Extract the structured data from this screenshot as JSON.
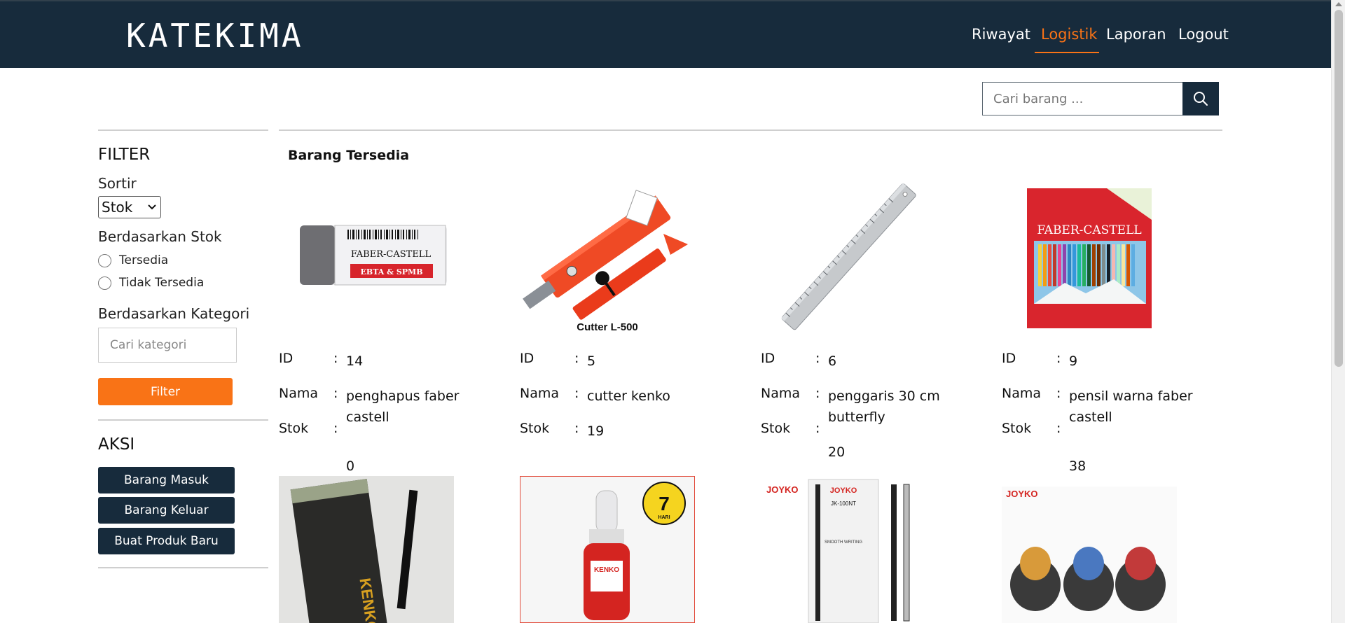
{
  "brand": "KATEKIMA",
  "nav": {
    "items": [
      {
        "label": "Riwayat",
        "active": false
      },
      {
        "label": "Logistik",
        "active": true
      },
      {
        "label": "Laporan",
        "active": false
      },
      {
        "label": "Logout",
        "active": false
      }
    ]
  },
  "search": {
    "placeholder": "Cari barang ...",
    "icon": "search-icon"
  },
  "sidebar": {
    "filter_heading": "FILTER",
    "sortir_label": "Sortir",
    "sortir_selected": "Stok",
    "stok_label": "Berdasarkan Stok",
    "stok_options": [
      "Tersedia",
      "Tidak Tersedia"
    ],
    "kategori_label": "Berdasarkan Kategori",
    "kategori_placeholder": "Cari kategori",
    "filter_button": "Filter",
    "aksi_heading": "AKSI",
    "aksi_buttons": [
      "Barang Masuk",
      "Barang Keluar",
      "Buat Produk Baru"
    ]
  },
  "main": {
    "section_title": "Barang Tersedia",
    "labels": {
      "id": "ID",
      "nama": "Nama",
      "stok": "Stok",
      "sep": ":"
    },
    "products": [
      {
        "id": "14",
        "nama": "penghapus faber castell",
        "stok": "0",
        "image": "eraser",
        "image_text": [
          "FABER-CASTELL",
          "EBTA & SPMB"
        ]
      },
      {
        "id": "5",
        "nama": "cutter kenko",
        "stok": "19",
        "image": "cutter",
        "image_text": [
          "Cutter L-500"
        ]
      },
      {
        "id": "6",
        "nama": "penggaris 30 cm butterfly",
        "stok": "20",
        "image": "ruler",
        "image_text": []
      },
      {
        "id": "9",
        "nama": "pensil warna faber castell",
        "stok": "38",
        "image": "color-pencils",
        "image_text": [
          "FABER-CASTELL"
        ]
      }
    ],
    "bottom_images": [
      {
        "image": "gel-pen-kenko",
        "text": [
          "KENKO"
        ]
      },
      {
        "image": "correction-fluid",
        "text": [
          "KENKO",
          "7",
          "HARI"
        ]
      },
      {
        "image": "gel-pen-joyko",
        "text": [
          "JOYKO",
          "JOYKO",
          "JK-100NT",
          "SMOOTH WRITING"
        ]
      },
      {
        "image": "correction-tape",
        "text": [
          "JOYKO"
        ]
      }
    ]
  },
  "colors": {
    "navy": "#172b3c",
    "orange": "#f97316"
  }
}
